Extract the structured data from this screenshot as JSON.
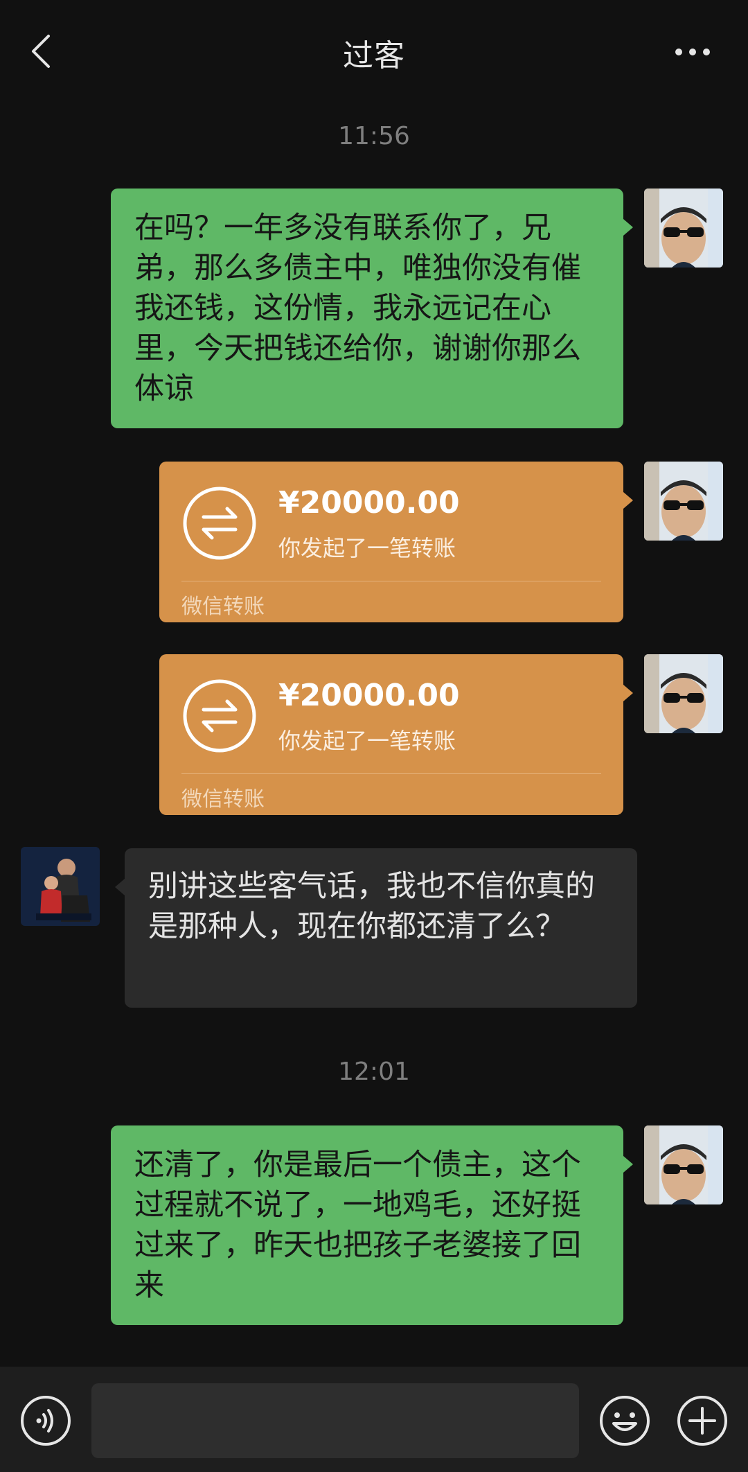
{
  "header": {
    "title": "过客",
    "back_icon": "chevron-left-icon",
    "more_icon": "more-dots-icon"
  },
  "messages": [
    {
      "kind": "timestamp",
      "text": "11:56"
    },
    {
      "kind": "text",
      "side": "right",
      "text": "在吗？一年多没有联系你了，兄弟，那么多债主中，唯独你没有催我还钱，这份情，我永远记在心里，今天把钱还给你，谢谢你那么体谅"
    },
    {
      "kind": "transfer",
      "side": "right",
      "amount": "¥20000.00",
      "desc": "你发起了一笔转账",
      "brand": "微信转账"
    },
    {
      "kind": "transfer",
      "side": "right",
      "amount": "¥20000.00",
      "desc": "你发起了一笔转账",
      "brand": "微信转账"
    },
    {
      "kind": "text",
      "side": "left",
      "text": "别讲这些客气话，我也不信你真的是那种人，现在你都还清了么？"
    },
    {
      "kind": "timestamp",
      "text": "12:01"
    },
    {
      "kind": "text",
      "side": "right",
      "text": "还清了，你是最后一个债主，这个过程就不说了，一地鸡毛，还好挺过来了，昨天也把孩子老婆接了回来"
    }
  ],
  "input_bar": {
    "value": "",
    "voice_icon": "voice-icon",
    "emoji_icon": "emoji-icon",
    "plus_icon": "plus-icon"
  },
  "colors": {
    "background": "#111111",
    "sent_bubble": "#5fb866",
    "received_bubble": "#2b2b2b",
    "transfer_card": "#d6924a"
  }
}
